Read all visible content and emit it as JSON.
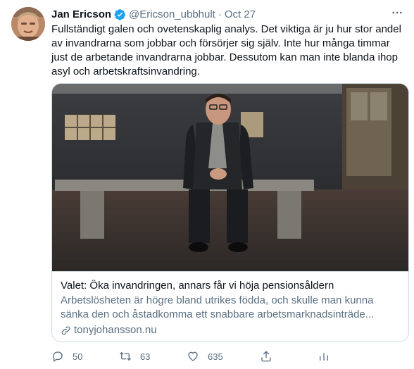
{
  "tweet": {
    "author_name": "Jan Ericson",
    "handle": "@Ericson_ubbhult",
    "separator": "·",
    "date": "Oct 27",
    "text": "Fullständigt galen och ovetenskaplig analys. Det viktiga är ju hur stor andel av invandrarna som jobbar och försörjer sig själv. Inte hur många timmar just de arbetande invandrarna jobbar. Dessutom kan man inte blanda ihop asyl och arbetskraftsinvandring."
  },
  "card": {
    "title": "Valet: Öka invandringen, annars får vi höja pensionsåldern",
    "description": "Arbetslösheten är högre bland utrikes födda, och skulle man kunna sänka den och åstadkomma ett snabbare arbetsmarknadsinträde...",
    "link": "tonyjohansson.nu"
  },
  "actions": {
    "replies": "50",
    "retweets": "63",
    "likes": "635"
  },
  "colors": {
    "text": "#0f1419",
    "secondary": "#5b7083",
    "verified": "#1da1f2",
    "border": "#cfd9de"
  },
  "icons": [
    "verified-badge-icon",
    "more-icon",
    "link-icon",
    "reply-icon",
    "retweet-icon",
    "like-icon",
    "share-icon",
    "analytics-icon"
  ]
}
